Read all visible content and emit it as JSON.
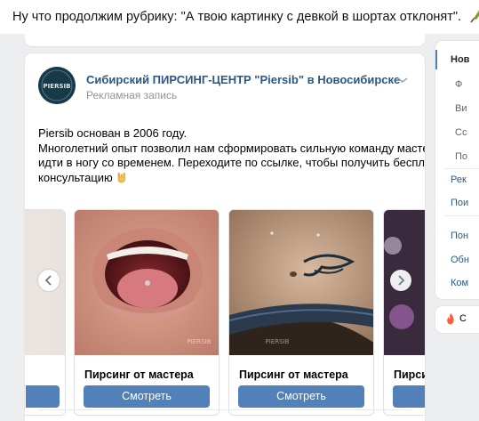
{
  "caption": {
    "text": "Ну что продолжим рубрику: \"А твою картинку с девкой в шортах отклонят\".",
    "emoji_icon": "champagne-icon"
  },
  "post": {
    "author": "Сибирский ПИРСИНГ-ЦЕНТР \"Piersib\" в Новосибирске",
    "ad_label": "Рекламная запись",
    "avatar_text": "PIERSIB",
    "text_lines": [
      "Piersib основан в 2006 году.",
      "Многолетний опыт позволил нам сформировать сильную команду мастеров и",
      "идти в ногу со временем. Переходите по ссылке, чтобы получить бесплатную",
      "консультацию"
    ],
    "text_emoji_icon": "rock-hand-icon"
  },
  "carousel": {
    "slides": [
      {
        "title": "Пирсинг от мастера",
        "button": "Смотреть",
        "watermark": "PIERSIB"
      },
      {
        "title": "Пирсинг от мастера",
        "button": "Смотреть",
        "watermark": "PIERSIB"
      },
      {
        "title": "Пирсин",
        "button": ""
      }
    ]
  },
  "right_menu": {
    "items": [
      {
        "label": "Нов",
        "style": "bold"
      },
      {
        "label": "Ф",
        "style": "muted"
      },
      {
        "label": "Ви",
        "style": "muted"
      },
      {
        "label": "Сс",
        "style": "muted"
      },
      {
        "label": "По",
        "style": "muted"
      },
      {
        "label": "Рек",
        "style": "link"
      },
      {
        "label": "Пои",
        "style": "link"
      },
      {
        "label": "Пон",
        "style": "link"
      },
      {
        "label": "Обн",
        "style": "link"
      },
      {
        "label": "Ком",
        "style": "link"
      }
    ],
    "bottom_label": "С"
  },
  "colors": {
    "link_blue": "#2a5885",
    "button_blue": "#5181b8",
    "background": "#edeef0"
  }
}
